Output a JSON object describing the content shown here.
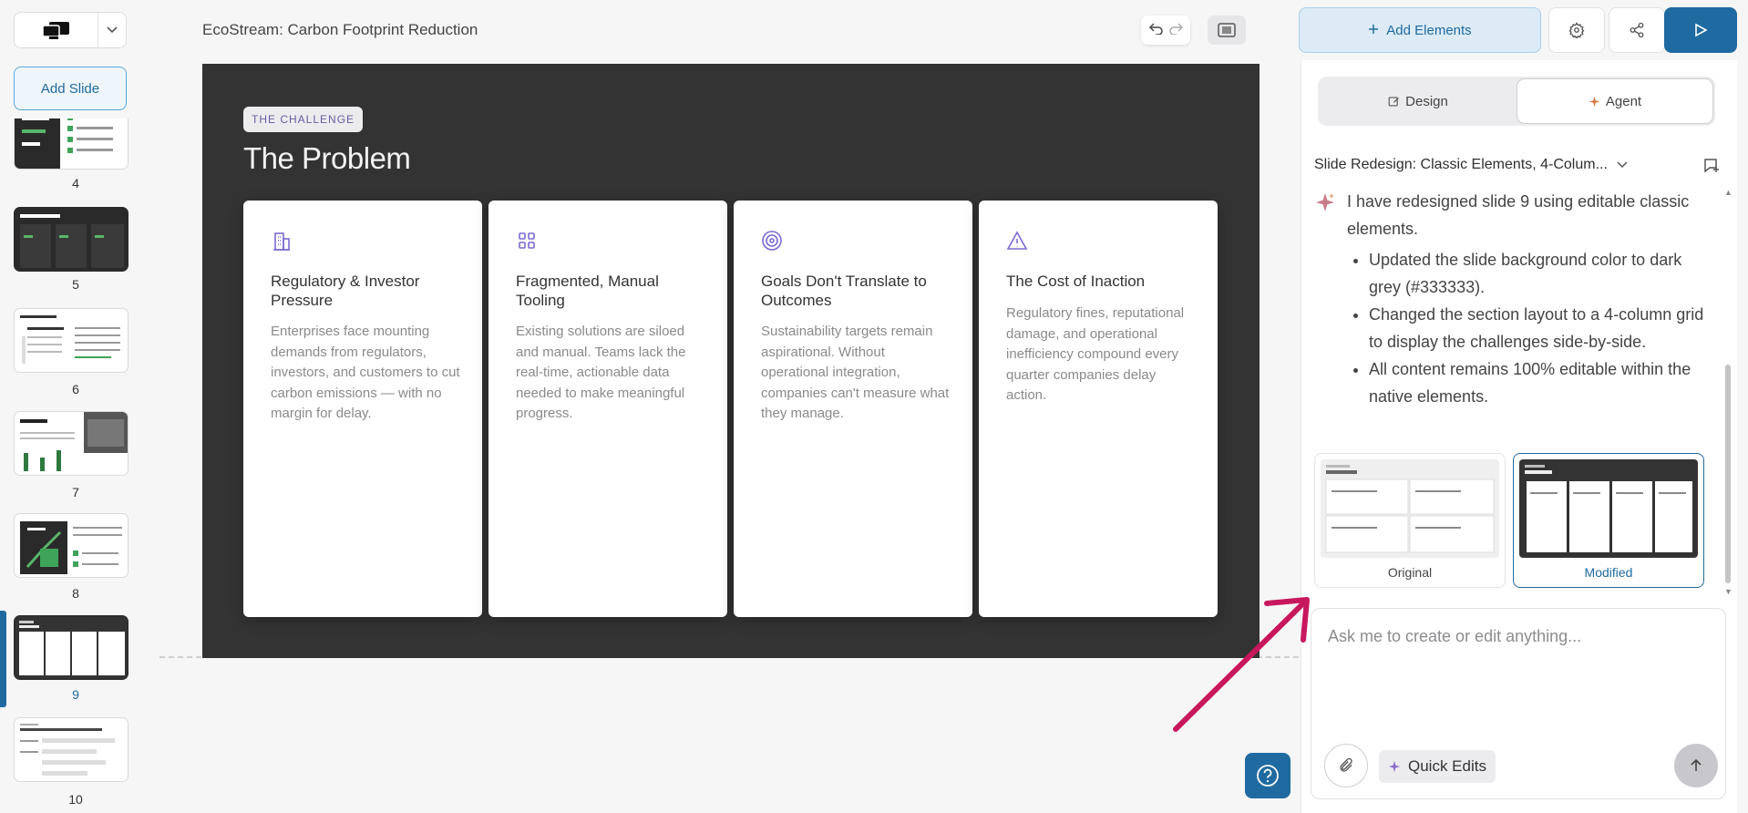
{
  "app": {
    "doc_title": "EcoStream: Carbon Footprint Reduction"
  },
  "sidebar": {
    "add_slide_label": "Add Slide",
    "slides": [
      {
        "num": "4"
      },
      {
        "num": "5"
      },
      {
        "num": "6"
      },
      {
        "num": "7"
      },
      {
        "num": "8"
      },
      {
        "num": "9"
      },
      {
        "num": "10"
      }
    ],
    "active_slide": "9"
  },
  "toolbar": {
    "add_elements_label": "Add Elements"
  },
  "slide": {
    "tag": "THE CHALLENGE",
    "heading": "The Problem",
    "background": "#333333",
    "cards": [
      {
        "icon": "building-icon",
        "title": "Regulatory & Investor Pressure",
        "body": "Enterprises face mounting demands from regulators, investors, and customers to cut carbon emissions — with no margin for delay."
      },
      {
        "icon": "grid-icon",
        "title": "Fragmented, Manual Tooling",
        "body": "Existing solutions are siloed and manual. Teams lack the real-time, actionable data needed to make meaningful progress."
      },
      {
        "icon": "target-icon",
        "title": "Goals Don't Translate to Outcomes",
        "body": "Sustainability targets remain aspirational. Without operational integration, companies can't measure what they manage."
      },
      {
        "icon": "alert-triangle-icon",
        "title": "The Cost of Inaction",
        "body": "Regulatory fines, reputational damage, and operational inefficiency compound every quarter companies delay action."
      }
    ]
  },
  "panel": {
    "tabs": [
      {
        "label": "Design",
        "active": false
      },
      {
        "label": "Agent",
        "active": true
      }
    ],
    "conversation_title": "Slide Redesign: Classic Elements, 4-Colum...",
    "message": {
      "intro": "I have redesigned slide 9 using editable classic elements.",
      "bullets": [
        "Updated the slide background color to dark grey (#333333).",
        "Changed the section layout to a 4-column grid to display the challenges side-by-side.",
        "All content remains 100% editable within the native elements."
      ]
    },
    "compare": {
      "original_label": "Original",
      "modified_label": "Modified"
    },
    "composer": {
      "placeholder": "Ask me to create or edit anything...",
      "quick_edits_label": "Quick Edits"
    }
  },
  "colors": {
    "accent": "#1f6aa0",
    "slide_bg": "#333333",
    "tag_text": "#6b5aa6",
    "annotation": "#c8175d"
  }
}
